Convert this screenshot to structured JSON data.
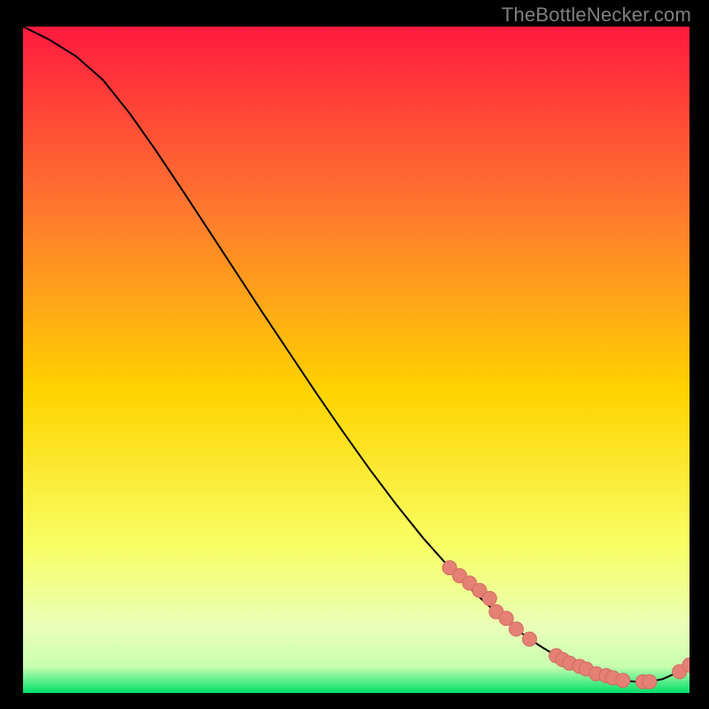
{
  "attribution": "TheBottleNecker.com",
  "colors": {
    "gradient_top": "#ff1a3f",
    "gradient_upper_mid": "#ff7a2e",
    "gradient_mid": "#ffd400",
    "gradient_lower_mid": "#f8ff66",
    "gradient_lower": "#c9ffb0",
    "gradient_bottom": "#00e06a",
    "curve": "#000000",
    "marker_fill": "#e58074",
    "marker_stroke": "#cf6b60"
  },
  "chart_data": {
    "type": "line",
    "title": "",
    "xlabel": "",
    "ylabel": "",
    "xlim": [
      0,
      100
    ],
    "ylim": [
      0,
      100
    ],
    "series": [
      {
        "name": "bottleneck-curve",
        "x": [
          0,
          4,
          8,
          12,
          16,
          20,
          24,
          28,
          32,
          36,
          40,
          44,
          48,
          52,
          56,
          60,
          64,
          68,
          72,
          74,
          76,
          78,
          80,
          82,
          84,
          86,
          88,
          90,
          92,
          94,
          96,
          98,
          100
        ],
        "y": [
          100,
          98,
          95.5,
          92,
          87,
          81.3,
          75.3,
          69.2,
          63.1,
          57.0,
          51.0,
          45.0,
          39.2,
          33.6,
          28.3,
          23.3,
          18.8,
          14.8,
          11.2,
          9.6,
          8.1,
          6.8,
          5.6,
          4.5,
          3.6,
          2.9,
          2.3,
          1.9,
          1.7,
          1.7,
          2.1,
          3.0,
          4.2
        ]
      }
    ],
    "markers": {
      "name": "highlighted-points",
      "x": [
        64,
        65.5,
        67,
        68.5,
        70,
        71,
        72.5,
        74,
        76,
        80,
        81,
        82,
        83.5,
        84.5,
        86,
        87.5,
        88.5,
        90,
        93,
        94,
        98.5,
        100
      ],
      "y": [
        18.8,
        17.6,
        16.5,
        15.4,
        14.2,
        12.2,
        11.2,
        9.6,
        8.1,
        5.6,
        5.0,
        4.5,
        4.0,
        3.6,
        2.9,
        2.6,
        2.3,
        1.9,
        1.7,
        1.7,
        3.2,
        4.2
      ]
    }
  }
}
